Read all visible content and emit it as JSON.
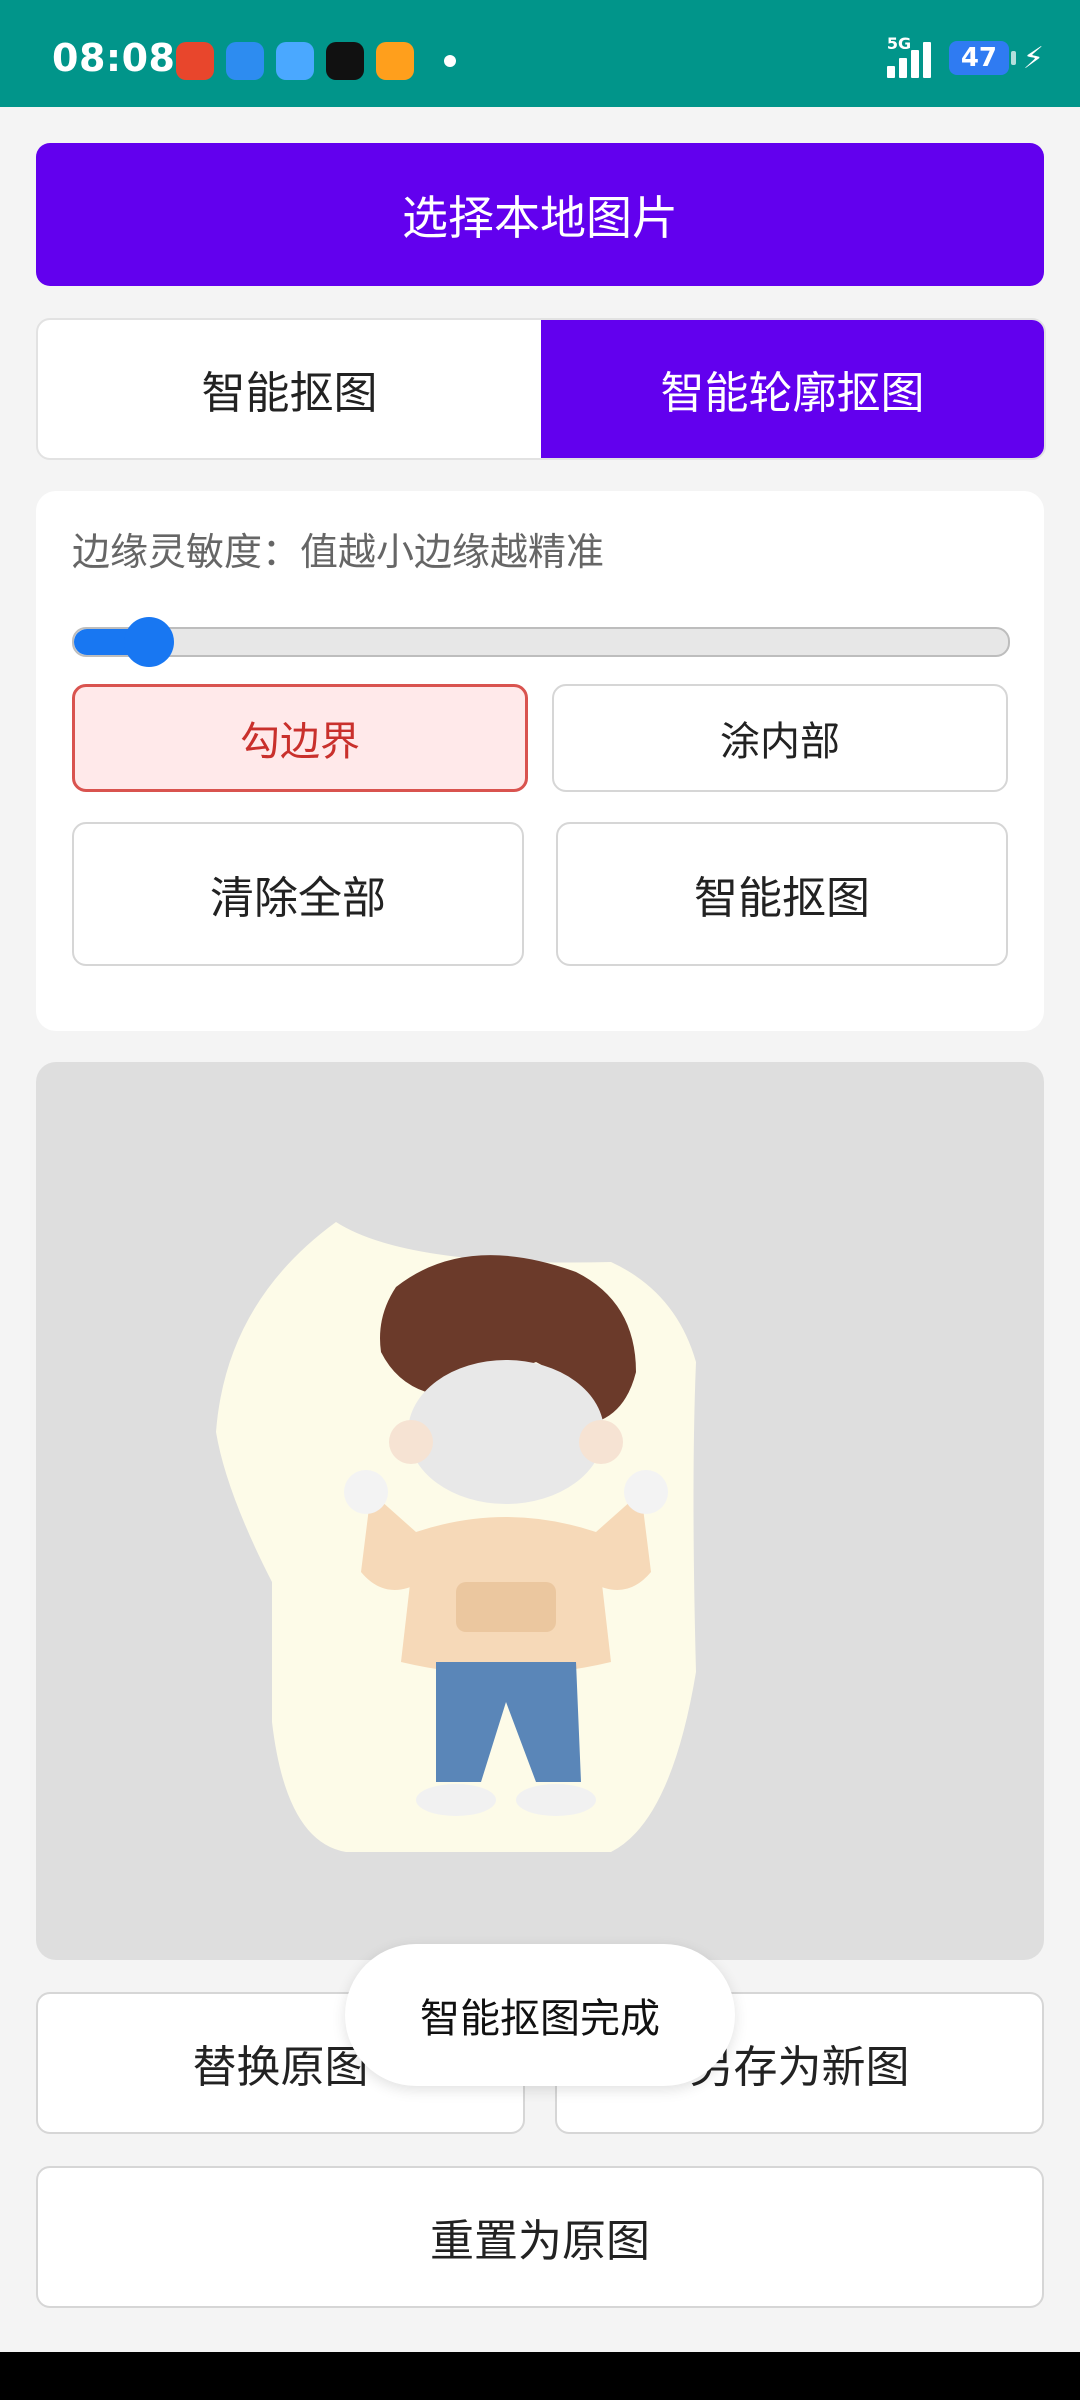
{
  "status_bar": {
    "time": "08:08",
    "network": "5G",
    "battery": "47",
    "app_icons": [
      "shop-app-icon",
      "browser-app-icon",
      "weather-app-icon",
      "tiktok-app-icon",
      "video-app-icon"
    ]
  },
  "actions": {
    "select_image": "选择本地图片"
  },
  "tabs": [
    {
      "label": "智能抠图",
      "active": false
    },
    {
      "label": "智能轮廓抠图",
      "active": true
    }
  ],
  "settings": {
    "sensitivity_hint": "边缘灵敏度：值越小边缘越精准",
    "slider_value": 0.08,
    "buttons": {
      "outline": "勾边界",
      "paint_inside": "涂内部",
      "clear_all": "清除全部",
      "smart_cutout": "智能抠图"
    }
  },
  "bottom": {
    "replace_original": "替换原图",
    "save_as_new": "另存为新图",
    "reset_original": "重置为原图"
  },
  "toast": "智能抠图完成",
  "colors": {
    "status_bar": "#01958a",
    "primary": "#6200ee",
    "slider": "#1877f2",
    "selected_border": "#d9534f",
    "canvas": "#dedede"
  }
}
